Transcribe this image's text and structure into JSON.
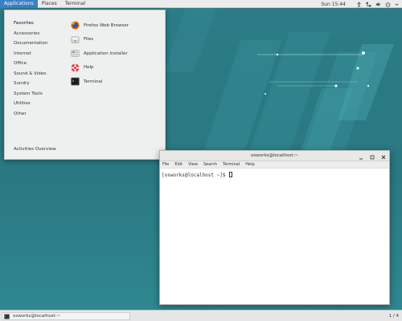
{
  "top_bar": {
    "applications": "Applications",
    "places": "Places",
    "terminal": "Terminal",
    "clock": "Sun 15:44",
    "tray_icons": [
      "accessibility-icon",
      "network-icon",
      "volume-icon",
      "power-icon"
    ]
  },
  "apps_menu": {
    "categories": [
      "Favorites",
      "Accessories",
      "Documentation",
      "Internet",
      "Office",
      "Sound & Video",
      "Sundry",
      "System Tools",
      "Utilities",
      "Other"
    ],
    "selected_category": "Favorites",
    "favorites": [
      {
        "label": "Firefox Web Browser",
        "icon": "firefox-icon"
      },
      {
        "label": "Files",
        "icon": "files-icon"
      },
      {
        "label": "Application Installer",
        "icon": "installer-icon"
      },
      {
        "label": "Help",
        "icon": "help-icon"
      },
      {
        "label": "Terminal",
        "icon": "terminal-icon"
      }
    ],
    "activities_overview": "Activities Overview"
  },
  "terminal_window": {
    "title": "osworks@localhost:~",
    "menu": [
      "File",
      "Edit",
      "View",
      "Search",
      "Terminal",
      "Help"
    ],
    "prompt": "[osworks@localhost ~]$ "
  },
  "taskbar": {
    "window_entry": "osworks@localhost:~",
    "workspace": "1 / 4"
  },
  "colors": {
    "desktop": "#2d7f88",
    "menu_highlight": "#3d7fc4",
    "panel": "#ececec"
  }
}
